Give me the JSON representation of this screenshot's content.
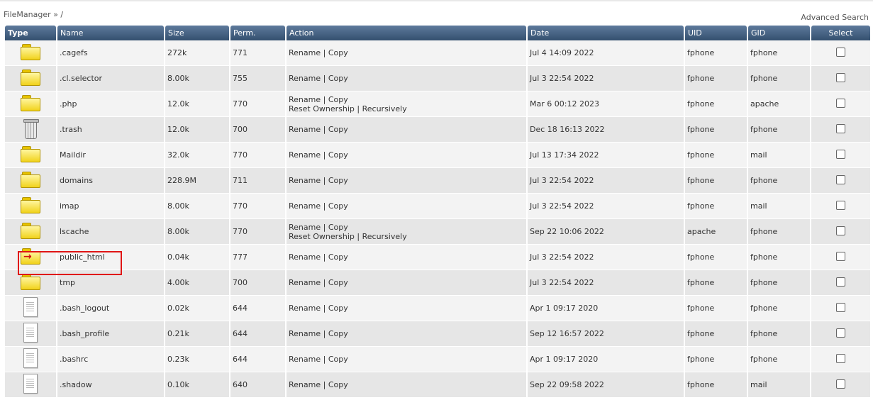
{
  "breadcrumb": "FileManager » /",
  "advanced_search": "Advanced Search",
  "columns": [
    "Type",
    "Name",
    "Size",
    "Perm.",
    "Action",
    "Date",
    "UID",
    "GID",
    "Select"
  ],
  "actions": {
    "rename": "Rename",
    "copy": "Copy",
    "separator": "|",
    "reset_ownership": "Reset Ownership",
    "recursively": "Recursively"
  },
  "rows": [
    {
      "icon": "folder-icon",
      "name": ".cagefs",
      "size": "272k",
      "perm": "771",
      "extended": false,
      "date": "Jul 4 14:09 2022",
      "uid": "fphone",
      "gid": "fphone"
    },
    {
      "icon": "folder-icon",
      "name": ".cl.selector",
      "size": "8.00k",
      "perm": "755",
      "extended": false,
      "date": "Jul 3 22:54 2022",
      "uid": "fphone",
      "gid": "fphone"
    },
    {
      "icon": "folder-icon",
      "name": ".php",
      "size": "12.0k",
      "perm": "770",
      "extended": true,
      "date": "Mar 6 00:12 2023",
      "uid": "fphone",
      "gid": "apache"
    },
    {
      "icon": "trash-icon",
      "name": ".trash",
      "size": "12.0k",
      "perm": "700",
      "extended": false,
      "date": "Dec 18 16:13 2022",
      "uid": "fphone",
      "gid": "fphone"
    },
    {
      "icon": "folder-icon",
      "name": "Maildir",
      "size": "32.0k",
      "perm": "770",
      "extended": false,
      "date": "Jul 13 17:34 2022",
      "uid": "fphone",
      "gid": "mail"
    },
    {
      "icon": "folder-icon",
      "name": "domains",
      "size": "228.9M",
      "perm": "711",
      "extended": false,
      "date": "Jul 3 22:54 2022",
      "uid": "fphone",
      "gid": "fphone"
    },
    {
      "icon": "folder-icon",
      "name": "imap",
      "size": "8.00k",
      "perm": "770",
      "extended": false,
      "date": "Jul 3 22:54 2022",
      "uid": "fphone",
      "gid": "mail"
    },
    {
      "icon": "folder-icon",
      "name": "lscache",
      "size": "8.00k",
      "perm": "770",
      "extended": true,
      "date": "Sep 22 10:06 2022",
      "uid": "apache",
      "gid": "fphone"
    },
    {
      "icon": "symlink-folder-icon",
      "name": "public_html",
      "size": "0.04k",
      "perm": "777",
      "extended": false,
      "date": "Jul 3 22:54 2022",
      "uid": "fphone",
      "gid": "fphone"
    },
    {
      "icon": "folder-icon",
      "name": "tmp",
      "size": "4.00k",
      "perm": "700",
      "extended": false,
      "date": "Jul 3 22:54 2022",
      "uid": "fphone",
      "gid": "fphone"
    },
    {
      "icon": "file-icon",
      "name": ".bash_logout",
      "size": "0.02k",
      "perm": "644",
      "extended": false,
      "date": "Apr 1 09:17 2020",
      "uid": "fphone",
      "gid": "fphone"
    },
    {
      "icon": "file-icon",
      "name": ".bash_profile",
      "size": "0.21k",
      "perm": "644",
      "extended": false,
      "date": "Sep 12 16:57 2022",
      "uid": "fphone",
      "gid": "fphone"
    },
    {
      "icon": "file-icon",
      "name": ".bashrc",
      "size": "0.23k",
      "perm": "644",
      "extended": false,
      "date": "Apr 1 09:17 2020",
      "uid": "fphone",
      "gid": "fphone"
    },
    {
      "icon": "file-icon",
      "name": ".shadow",
      "size": "0.10k",
      "perm": "640",
      "extended": false,
      "date": "Sep 22 09:58 2022",
      "uid": "fphone",
      "gid": "mail"
    }
  ],
  "colors": {
    "header_top": "#5e7a9c",
    "header_bottom": "#34506f",
    "row_odd": "#f3f3f3",
    "row_even": "#e6e6e6",
    "highlight": "#e01515"
  }
}
